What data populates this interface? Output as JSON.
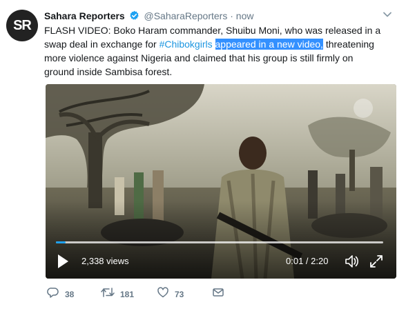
{
  "tweet": {
    "author_avatar_initials": "SR",
    "author_name": "Sahara Reporters",
    "author_handle": "@SaharaReporters",
    "separator": "·",
    "time": "now",
    "text_part1": "FLASH VIDEO: Boko Haram commander, Shuibu Moni, who was released in a swap deal in exchange for ",
    "hashtag": "#Chibokgirls",
    "text_space": " ",
    "selected_text": "appeared in a new video,",
    "text_part2": " threatening more violence against Nigeria and claimed that his group is still firmly on ground inside Sambisa forest."
  },
  "video": {
    "views": "2,338 views",
    "duration": "0:01 / 2:20",
    "progress": 0.007
  },
  "actions": {
    "reply_count": "38",
    "retweet_count": "181",
    "like_count": "73"
  },
  "colors": {
    "link": "#1b95e0",
    "selection": "#3390ff",
    "muted": "#657786",
    "verified": "#1da1f2"
  },
  "icons": [
    "verified-badge-icon",
    "chevron-down-icon",
    "play-icon",
    "volume-icon",
    "fullscreen-icon",
    "reply-icon",
    "retweet-icon",
    "like-icon",
    "direct-message-icon"
  ]
}
